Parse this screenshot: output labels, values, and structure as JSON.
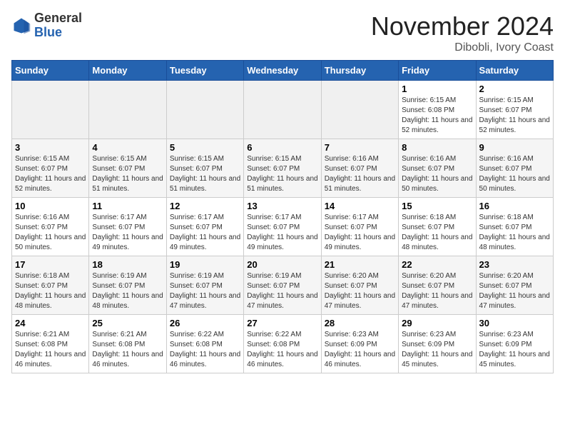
{
  "logo": {
    "general": "General",
    "blue": "Blue"
  },
  "header": {
    "title": "November 2024",
    "location": "Dibobli, Ivory Coast"
  },
  "days_of_week": [
    "Sunday",
    "Monday",
    "Tuesday",
    "Wednesday",
    "Thursday",
    "Friday",
    "Saturday"
  ],
  "weeks": [
    [
      {
        "day": "",
        "detail": ""
      },
      {
        "day": "",
        "detail": ""
      },
      {
        "day": "",
        "detail": ""
      },
      {
        "day": "",
        "detail": ""
      },
      {
        "day": "",
        "detail": ""
      },
      {
        "day": "1",
        "detail": "Sunrise: 6:15 AM\nSunset: 6:08 PM\nDaylight: 11 hours and 52 minutes."
      },
      {
        "day": "2",
        "detail": "Sunrise: 6:15 AM\nSunset: 6:07 PM\nDaylight: 11 hours and 52 minutes."
      }
    ],
    [
      {
        "day": "3",
        "detail": "Sunrise: 6:15 AM\nSunset: 6:07 PM\nDaylight: 11 hours and 52 minutes."
      },
      {
        "day": "4",
        "detail": "Sunrise: 6:15 AM\nSunset: 6:07 PM\nDaylight: 11 hours and 51 minutes."
      },
      {
        "day": "5",
        "detail": "Sunrise: 6:15 AM\nSunset: 6:07 PM\nDaylight: 11 hours and 51 minutes."
      },
      {
        "day": "6",
        "detail": "Sunrise: 6:15 AM\nSunset: 6:07 PM\nDaylight: 11 hours and 51 minutes."
      },
      {
        "day": "7",
        "detail": "Sunrise: 6:16 AM\nSunset: 6:07 PM\nDaylight: 11 hours and 51 minutes."
      },
      {
        "day": "8",
        "detail": "Sunrise: 6:16 AM\nSunset: 6:07 PM\nDaylight: 11 hours and 50 minutes."
      },
      {
        "day": "9",
        "detail": "Sunrise: 6:16 AM\nSunset: 6:07 PM\nDaylight: 11 hours and 50 minutes."
      }
    ],
    [
      {
        "day": "10",
        "detail": "Sunrise: 6:16 AM\nSunset: 6:07 PM\nDaylight: 11 hours and 50 minutes."
      },
      {
        "day": "11",
        "detail": "Sunrise: 6:17 AM\nSunset: 6:07 PM\nDaylight: 11 hours and 49 minutes."
      },
      {
        "day": "12",
        "detail": "Sunrise: 6:17 AM\nSunset: 6:07 PM\nDaylight: 11 hours and 49 minutes."
      },
      {
        "day": "13",
        "detail": "Sunrise: 6:17 AM\nSunset: 6:07 PM\nDaylight: 11 hours and 49 minutes."
      },
      {
        "day": "14",
        "detail": "Sunrise: 6:17 AM\nSunset: 6:07 PM\nDaylight: 11 hours and 49 minutes."
      },
      {
        "day": "15",
        "detail": "Sunrise: 6:18 AM\nSunset: 6:07 PM\nDaylight: 11 hours and 48 minutes."
      },
      {
        "day": "16",
        "detail": "Sunrise: 6:18 AM\nSunset: 6:07 PM\nDaylight: 11 hours and 48 minutes."
      }
    ],
    [
      {
        "day": "17",
        "detail": "Sunrise: 6:18 AM\nSunset: 6:07 PM\nDaylight: 11 hours and 48 minutes."
      },
      {
        "day": "18",
        "detail": "Sunrise: 6:19 AM\nSunset: 6:07 PM\nDaylight: 11 hours and 48 minutes."
      },
      {
        "day": "19",
        "detail": "Sunrise: 6:19 AM\nSunset: 6:07 PM\nDaylight: 11 hours and 47 minutes."
      },
      {
        "day": "20",
        "detail": "Sunrise: 6:19 AM\nSunset: 6:07 PM\nDaylight: 11 hours and 47 minutes."
      },
      {
        "day": "21",
        "detail": "Sunrise: 6:20 AM\nSunset: 6:07 PM\nDaylight: 11 hours and 47 minutes."
      },
      {
        "day": "22",
        "detail": "Sunrise: 6:20 AM\nSunset: 6:07 PM\nDaylight: 11 hours and 47 minutes."
      },
      {
        "day": "23",
        "detail": "Sunrise: 6:20 AM\nSunset: 6:07 PM\nDaylight: 11 hours and 47 minutes."
      }
    ],
    [
      {
        "day": "24",
        "detail": "Sunrise: 6:21 AM\nSunset: 6:08 PM\nDaylight: 11 hours and 46 minutes."
      },
      {
        "day": "25",
        "detail": "Sunrise: 6:21 AM\nSunset: 6:08 PM\nDaylight: 11 hours and 46 minutes."
      },
      {
        "day": "26",
        "detail": "Sunrise: 6:22 AM\nSunset: 6:08 PM\nDaylight: 11 hours and 46 minutes."
      },
      {
        "day": "27",
        "detail": "Sunrise: 6:22 AM\nSunset: 6:08 PM\nDaylight: 11 hours and 46 minutes."
      },
      {
        "day": "28",
        "detail": "Sunrise: 6:23 AM\nSunset: 6:09 PM\nDaylight: 11 hours and 46 minutes."
      },
      {
        "day": "29",
        "detail": "Sunrise: 6:23 AM\nSunset: 6:09 PM\nDaylight: 11 hours and 45 minutes."
      },
      {
        "day": "30",
        "detail": "Sunrise: 6:23 AM\nSunset: 6:09 PM\nDaylight: 11 hours and 45 minutes."
      }
    ]
  ]
}
